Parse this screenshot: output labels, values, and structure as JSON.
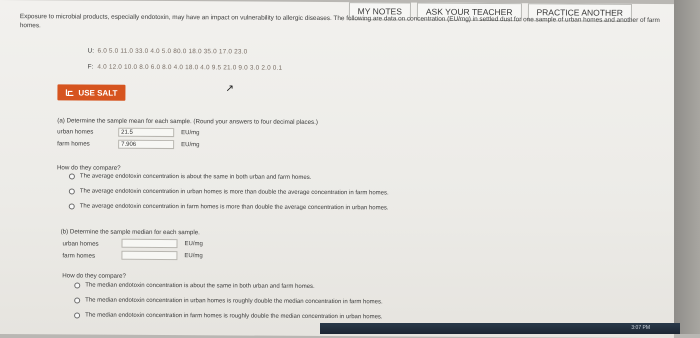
{
  "top_buttons": [
    {
      "label": "MY NOTES"
    },
    {
      "label": "ASK YOUR TEACHER"
    },
    {
      "label": "PRACTICE ANOTHER"
    }
  ],
  "intro": "Exposure to microbial products, especially endotoxin, may have an impact on vulnerability to allergic diseases. The following are data on concentration (EU/mg) in settled dust for one sample of urban homes and another of farm homes.",
  "data": {
    "urban_label": "U:",
    "urban_values": "6.0   5.0  11.0  33.0  4.0  5.0  80.0  18.0  35.0  17.0  23.0",
    "farm_label": "F:",
    "farm_values": "4.0  12.0  10.0   8.0  6.0  8.0   4.0  18.0   4.0   9.5  21.0  9.0  3.0  2.0  0.1"
  },
  "salt_button": {
    "label": "USE SALT"
  },
  "part_a": {
    "prompt": "(a) Determine the sample mean for each sample. (Round your answers to four decimal places.)",
    "urban_label": "urban homes",
    "urban_value": "21.5",
    "farm_label": "farm homes",
    "farm_value": "7.906",
    "unit": "EU/mg"
  },
  "compare_a": {
    "question": "How do they compare?",
    "options": [
      "The average endotoxin concentration is about the same in both urban and farm homes.",
      "The average endotoxin concentration in urban homes is more than double the average concentration in farm homes.",
      "The average endotoxin concentration in farm homes is more than double the average concentration in urban homes."
    ]
  },
  "part_b": {
    "prompt": "(b) Determine the sample median for each sample.",
    "urban_label": "urban homes",
    "urban_value": "",
    "farm_label": "farm homes",
    "farm_value": "",
    "unit": "EU/mg"
  },
  "compare_b": {
    "question": "How do they compare?",
    "options": [
      "The median endotoxin concentration is about the same in both urban and farm homes.",
      "The median endotoxin concentration in urban homes is roughly double the median concentration in farm homes.",
      "The median endotoxin concentration in farm homes is roughly double the median concentration in urban homes."
    ]
  },
  "taskbar": {
    "clock": "3:07 PM"
  }
}
